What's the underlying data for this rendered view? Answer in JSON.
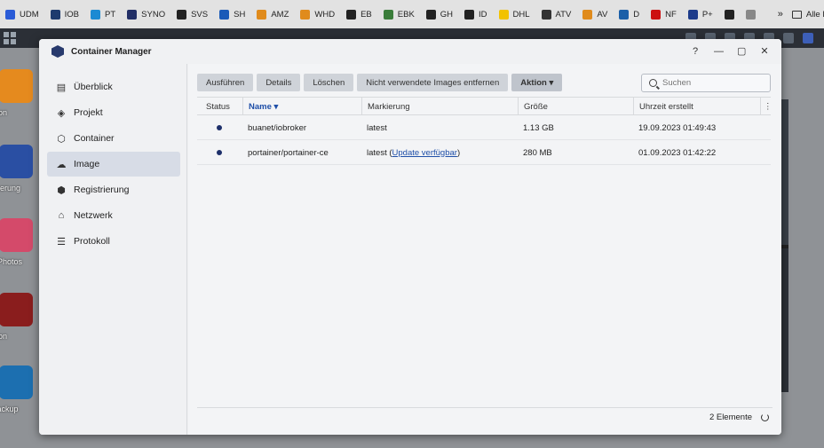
{
  "bookmarks": [
    {
      "label": "UDM",
      "color": "#2a5bd7"
    },
    {
      "label": "IOB",
      "color": "#1e3b6e"
    },
    {
      "label": "PT",
      "color": "#1b8ad3"
    },
    {
      "label": "SYNO",
      "color": "#222f66"
    },
    {
      "label": "SVS",
      "color": "#222"
    },
    {
      "label": "SH",
      "color": "#1a5ab8"
    },
    {
      "label": "AMZ",
      "color": "#e08b1c"
    },
    {
      "label": "WHD",
      "color": "#e08b1c"
    },
    {
      "label": "EB",
      "color": "#222"
    },
    {
      "label": "EBK",
      "color": "#3a7d3a"
    },
    {
      "label": "GH",
      "color": "#222"
    },
    {
      "label": "ID",
      "color": "#222"
    },
    {
      "label": "DHL",
      "color": "#f2c200"
    },
    {
      "label": "ATV",
      "color": "#333"
    },
    {
      "label": "AV",
      "color": "#e08b1c"
    },
    {
      "label": "D",
      "color": "#1b5fa8"
    },
    {
      "label": "NF",
      "color": "#c11"
    },
    {
      "label": "P+",
      "color": "#1d3b8a"
    },
    {
      "label": "",
      "color": "#222"
    },
    {
      "label": "",
      "color": "#888"
    }
  ],
  "bookmarks_more": "»",
  "bookmarks_folder": "Alle Lesezeichen",
  "desktop_icons": [
    {
      "label": "Station",
      "color": "#e58a1e"
    },
    {
      "label": "rsteuerung",
      "color": "#2a4fa3"
    },
    {
      "label": "ogy Photos",
      "color": "#d44a6a"
    },
    {
      "label": "Station",
      "color": "#8a1d1d"
    },
    {
      "label": "er Backup",
      "color": "#1c6fb0"
    }
  ],
  "window": {
    "title": "Container Manager",
    "controls": {
      "help": "?",
      "minimize": "—",
      "maximize": "▢",
      "close": "✕"
    }
  },
  "sidebar": {
    "items": [
      {
        "label": "Überblick",
        "icon": "overview-icon",
        "glyph": "▤",
        "active": false
      },
      {
        "label": "Projekt",
        "icon": "project-icon",
        "glyph": "◈",
        "active": false
      },
      {
        "label": "Container",
        "icon": "container-icon",
        "glyph": "⬡",
        "active": false
      },
      {
        "label": "Image",
        "icon": "cloud-icon",
        "glyph": "☁",
        "active": true
      },
      {
        "label": "Registrierung",
        "icon": "registry-icon",
        "glyph": "⬢",
        "active": false
      },
      {
        "label": "Netzwerk",
        "icon": "network-icon",
        "glyph": "⌂",
        "active": false
      },
      {
        "label": "Protokoll",
        "icon": "log-icon",
        "glyph": "☰",
        "active": false
      }
    ]
  },
  "toolbar": {
    "run": "Ausführen",
    "details": "Details",
    "delete": "Löschen",
    "remove_unused": "Nicht verwendete Images entfernen",
    "action": "Aktion ▾"
  },
  "search": {
    "placeholder": "Suchen"
  },
  "table": {
    "columns": {
      "status": "Status",
      "name": "Name ▾",
      "tag": "Markierung",
      "size": "Größe",
      "created": "Uhrzeit erstellt",
      "menu": "⋮"
    },
    "rows": [
      {
        "name": "buanet/iobroker",
        "tag": "latest",
        "tag_link": "",
        "tag_suffix": "",
        "size": "1.13 GB",
        "created": "19.09.2023 01:49:43"
      },
      {
        "name": "portainer/portainer-ce",
        "tag": "latest (",
        "tag_link": "Update verfügbar",
        "tag_suffix": ")",
        "size": "280 MB",
        "created": "01.09.2023 01:42:22"
      }
    ]
  },
  "footer": {
    "count": "2 Elemente"
  }
}
